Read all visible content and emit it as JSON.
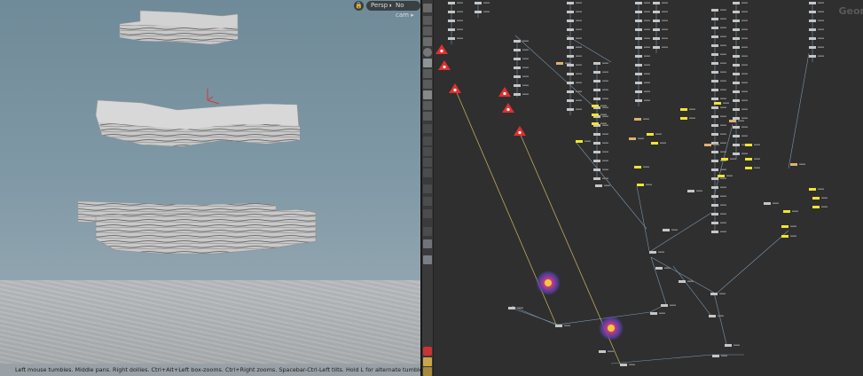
{
  "viewport": {
    "camera_menu": "Persp",
    "cam_menu": "No cam",
    "lock_icon": "lock-icon",
    "status_text": "Left mouse tumbles. Middle pans. Right dollies. Ctrl+Alt+Left box-zooms. Ctrl+Right zooms. Spacebar-Ctrl-Left tilts. Hold L for alternate tumble, dolly, and zoom."
  },
  "network": {
    "title": "Geor"
  },
  "toolbar": {
    "icons": [
      "select-icon",
      "pose-icon",
      "lock-icon",
      "box-icon",
      "sphere-icon",
      "view-icon",
      "paint-icon",
      "pin-icon",
      "transform-icon",
      "snap-icon",
      "magnet-icon",
      "grid-icon",
      "light-icon",
      "camera-icon",
      "handle-icon",
      "brush-icon",
      "pencil-icon",
      "render-icon",
      "display-icon",
      "flip-icon",
      "snapshot-icon",
      "warning-icon",
      "color-icon"
    ]
  },
  "colors": {
    "node_gray": "#c6c6c6",
    "node_yellow": "#f3e52e",
    "node_orange": "#e0b070",
    "wire": "#7b97b3",
    "warning": "#e03030"
  }
}
